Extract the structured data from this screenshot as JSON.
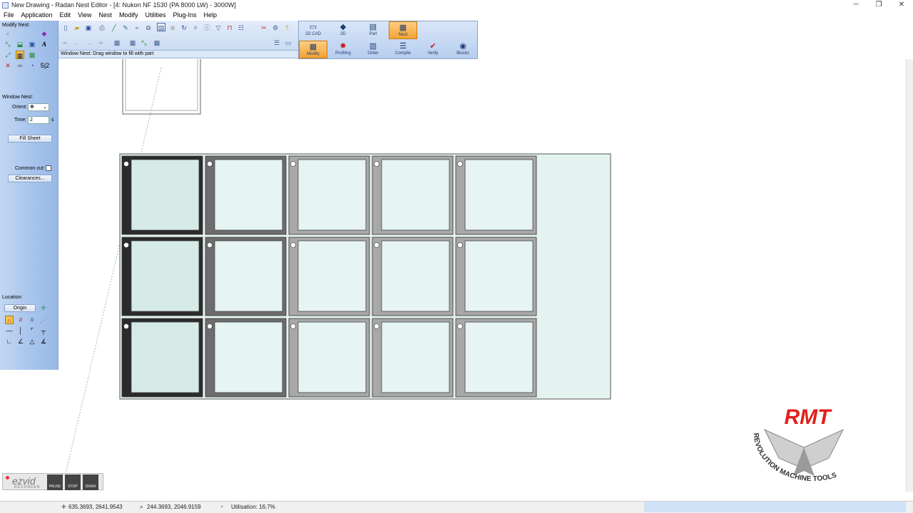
{
  "window": {
    "title": "New Drawing - Radan Nest Editor - [4: Nukon NF 1530 (PA 8000 LW) - 3000W]",
    "minimize": "─",
    "restore": "❐",
    "close": "✕"
  },
  "menu": [
    "File",
    "Application",
    "Edit",
    "View",
    "Nest",
    "Modify",
    "Utilities",
    "Plug-Ins",
    "Help"
  ],
  "left_panel": {
    "modify_nest_label": "Modify Nest:",
    "ratio_label": "5|2",
    "window_nest_label": "Window Nest:",
    "orient_label": "Orient:",
    "orient_icon": "✥",
    "time_label": "Time:",
    "time_value": "2",
    "time_unit": "s",
    "fill_sheet": "Fill Sheet",
    "common_cut_label": "Common cut:",
    "clearances": "Clearances...",
    "location_label": "Location:",
    "origin": "Origin"
  },
  "hint": "Window Nest: Drag window to fill with part",
  "mode_tabs_top": [
    {
      "label": "2D CAD",
      "icon": "▭"
    },
    {
      "label": "3D",
      "icon": "◆"
    },
    {
      "label": "Part",
      "icon": "▤"
    },
    {
      "label": "Nest",
      "icon": "▦"
    }
  ],
  "mode_tabs_bottom": [
    {
      "label": "Modify",
      "icon": "▦"
    },
    {
      "label": "Profiling",
      "icon": "✹"
    },
    {
      "label": "Order",
      "icon": "▥"
    },
    {
      "label": "Compile",
      "icon": "☰"
    },
    {
      "label": "Verify",
      "icon": "✔"
    },
    {
      "label": "Blocks",
      "icon": "◉"
    }
  ],
  "status": {
    "cursor": "635.3693, 2641.9543",
    "relative": "244.3693, 2046.9159",
    "utilisation": "Utilisation: 16.7%"
  },
  "nest": {
    "rows": 3,
    "cols": 5
  },
  "logo": {
    "text": "RMT",
    "ring_text": "REVOLUTION MACHINE TOOLS",
    "color": "#e0211b"
  },
  "recorder": {
    "logo": "ezvid",
    "sub": "RECORDER",
    "pause": "PAUSE",
    "stop": "STOP",
    "draw": "DRAW"
  },
  "colors": {
    "sheet": "#e4f2f0",
    "part_dark": "#2b2b2b",
    "part_mid": "#6d6d6d",
    "part_light": "#a8a8a8"
  }
}
